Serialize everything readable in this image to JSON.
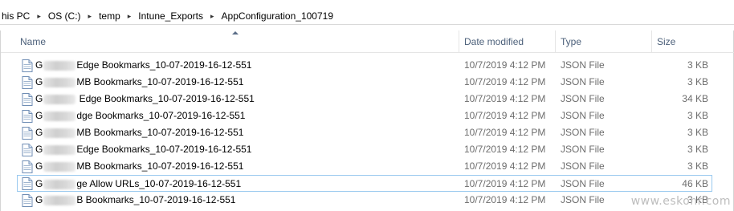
{
  "breadcrumb": {
    "items": [
      "his PC",
      "OS (C:)",
      "temp",
      "Intune_Exports",
      "AppConfiguration_100719"
    ],
    "separator": "▸"
  },
  "columns": {
    "name": "Name",
    "date": "Date modified",
    "type": "Type",
    "size": "Size"
  },
  "files": [
    {
      "prefix": "G",
      "name": "Edge Bookmarks_10-07-2019-16-12-551",
      "date": "10/7/2019 4:12 PM",
      "type": "JSON File",
      "size": "3 KB"
    },
    {
      "prefix": "G",
      "name": "MB Bookmarks_10-07-2019-16-12-551",
      "date": "10/7/2019 4:12 PM",
      "type": "JSON File",
      "size": "3 KB"
    },
    {
      "prefix": "G",
      "name": " Edge Bookmarks_10-07-2019-16-12-551",
      "date": "10/7/2019 4:12 PM",
      "type": "JSON File",
      "size": "34 KB"
    },
    {
      "prefix": "G",
      "name": "dge Bookmarks_10-07-2019-16-12-551",
      "date": "10/7/2019 4:12 PM",
      "type": "JSON File",
      "size": "3 KB"
    },
    {
      "prefix": "G",
      "name": "MB Bookmarks_10-07-2019-16-12-551",
      "date": "10/7/2019 4:12 PM",
      "type": "JSON File",
      "size": "3 KB"
    },
    {
      "prefix": "G",
      "name": "Edge Bookmarks_10-07-2019-16-12-551",
      "date": "10/7/2019 4:12 PM",
      "type": "JSON File",
      "size": "3 KB"
    },
    {
      "prefix": "G",
      "name": "MB Bookmarks_10-07-2019-16-12-551",
      "date": "10/7/2019 4:12 PM",
      "type": "JSON File",
      "size": "3 KB"
    },
    {
      "prefix": "G",
      "name": "ge Allow URLs_10-07-2019-16-12-551",
      "date": "10/7/2019 4:12 PM",
      "type": "JSON File",
      "size": "46 KB"
    },
    {
      "prefix": "G",
      "name": "B Bookmarks_10-07-2019-16-12-551",
      "date": "10/7/2019 4:12 PM",
      "type": "JSON File",
      "size": "3 KB"
    }
  ],
  "selected_index": 7,
  "watermark": "www.eskonr.com",
  "colors": {
    "header_text": "#4c607a",
    "meta_text": "#6d6d6d",
    "selection_border": "#99c9ef"
  }
}
